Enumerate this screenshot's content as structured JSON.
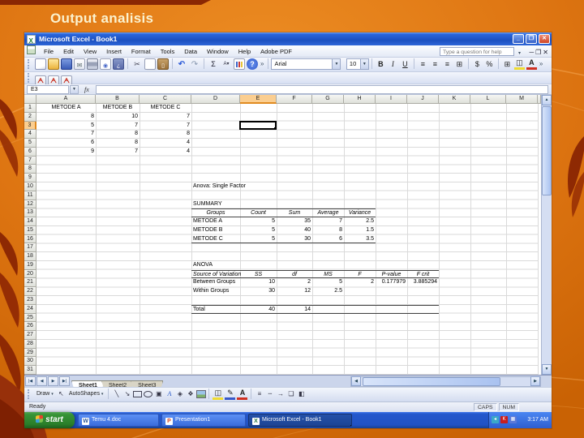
{
  "slide": {
    "title": "Output analisis"
  },
  "window": {
    "title": "Microsoft Excel - Book1"
  },
  "menu": {
    "items": [
      "File",
      "Edit",
      "View",
      "Insert",
      "Format",
      "Tools",
      "Data",
      "Window",
      "Help",
      "Adobe PDF"
    ],
    "help_box": "Type a question for help"
  },
  "toolbar": {
    "font_name": "Arial",
    "font_size": "10"
  },
  "formula_bar": {
    "name_box": "E3",
    "fx_label": "fx",
    "value": ""
  },
  "grid": {
    "columns": [
      "A",
      "B",
      "C",
      "D",
      "E",
      "F",
      "G",
      "H",
      "I",
      "J",
      "K",
      "L",
      "M"
    ],
    "row_count": 31,
    "selected_cell": {
      "col": "E",
      "row": 3
    },
    "cells": [
      {
        "r": 1,
        "c": "A",
        "t": "METODE A",
        "al": "c"
      },
      {
        "r": 1,
        "c": "B",
        "t": "METODE B",
        "al": "c"
      },
      {
        "r": 1,
        "c": "C",
        "t": "METODE C",
        "al": "c"
      },
      {
        "r": 2,
        "c": "A",
        "t": "8",
        "al": "r"
      },
      {
        "r": 2,
        "c": "B",
        "t": "10",
        "al": "r"
      },
      {
        "r": 2,
        "c": "C",
        "t": "7",
        "al": "r"
      },
      {
        "r": 3,
        "c": "A",
        "t": "5",
        "al": "r"
      },
      {
        "r": 3,
        "c": "B",
        "t": "7",
        "al": "r"
      },
      {
        "r": 3,
        "c": "C",
        "t": "7",
        "al": "r"
      },
      {
        "r": 4,
        "c": "A",
        "t": "7",
        "al": "r"
      },
      {
        "r": 4,
        "c": "B",
        "t": "8",
        "al": "r"
      },
      {
        "r": 4,
        "c": "C",
        "t": "8",
        "al": "r"
      },
      {
        "r": 5,
        "c": "A",
        "t": "6",
        "al": "r"
      },
      {
        "r": 5,
        "c": "B",
        "t": "8",
        "al": "r"
      },
      {
        "r": 5,
        "c": "C",
        "t": "4",
        "al": "r"
      },
      {
        "r": 6,
        "c": "A",
        "t": "9",
        "al": "r"
      },
      {
        "r": 6,
        "c": "B",
        "t": "7",
        "al": "r"
      },
      {
        "r": 6,
        "c": "C",
        "t": "4",
        "al": "r"
      },
      {
        "r": 10,
        "c": "D",
        "t": "Anova: Single Factor",
        "al": "l"
      },
      {
        "r": 12,
        "c": "D",
        "t": "SUMMARY",
        "al": "l"
      },
      {
        "r": 13,
        "c": "D",
        "t": "Groups",
        "al": "c",
        "it": true,
        "bt": true,
        "bb": true
      },
      {
        "r": 13,
        "c": "E",
        "t": "Count",
        "al": "c",
        "it": true,
        "bt": true,
        "bb": true
      },
      {
        "r": 13,
        "c": "F",
        "t": "Sum",
        "al": "c",
        "it": true,
        "bt": true,
        "bb": true
      },
      {
        "r": 13,
        "c": "G",
        "t": "Average",
        "al": "c",
        "it": true,
        "bt": true,
        "bb": true
      },
      {
        "r": 13,
        "c": "H",
        "t": "Variance",
        "al": "c",
        "it": true,
        "bt": true,
        "bb": true
      },
      {
        "r": 14,
        "c": "D",
        "t": "METODE A",
        "al": "l"
      },
      {
        "r": 14,
        "c": "E",
        "t": "5",
        "al": "r"
      },
      {
        "r": 14,
        "c": "F",
        "t": "35",
        "al": "r"
      },
      {
        "r": 14,
        "c": "G",
        "t": "7",
        "al": "r"
      },
      {
        "r": 14,
        "c": "H",
        "t": "2.5",
        "al": "r"
      },
      {
        "r": 15,
        "c": "D",
        "t": "METODE B",
        "al": "l"
      },
      {
        "r": 15,
        "c": "E",
        "t": "5",
        "al": "r"
      },
      {
        "r": 15,
        "c": "F",
        "t": "40",
        "al": "r"
      },
      {
        "r": 15,
        "c": "G",
        "t": "8",
        "al": "r"
      },
      {
        "r": 15,
        "c": "H",
        "t": "1.5",
        "al": "r"
      },
      {
        "r": 16,
        "c": "D",
        "t": "METODE C",
        "al": "l",
        "bb": true
      },
      {
        "r": 16,
        "c": "E",
        "t": "5",
        "al": "r",
        "bb": true
      },
      {
        "r": 16,
        "c": "F",
        "t": "30",
        "al": "r",
        "bb": true
      },
      {
        "r": 16,
        "c": "G",
        "t": "6",
        "al": "r",
        "bb": true
      },
      {
        "r": 16,
        "c": "H",
        "t": "3.5",
        "al": "r",
        "bb": true
      },
      {
        "r": 19,
        "c": "D",
        "t": "ANOVA",
        "al": "l"
      },
      {
        "r": 20,
        "c": "D",
        "t": "Source of Variation",
        "al": "l",
        "it": true,
        "bt": true,
        "bb": true
      },
      {
        "r": 20,
        "c": "E",
        "t": "SS",
        "al": "c",
        "it": true,
        "bt": true,
        "bb": true
      },
      {
        "r": 20,
        "c": "F",
        "t": "df",
        "al": "c",
        "it": true,
        "bt": true,
        "bb": true
      },
      {
        "r": 20,
        "c": "G",
        "t": "MS",
        "al": "c",
        "it": true,
        "bt": true,
        "bb": true
      },
      {
        "r": 20,
        "c": "H",
        "t": "F",
        "al": "c",
        "it": true,
        "bt": true,
        "bb": true
      },
      {
        "r": 20,
        "c": "I",
        "t": "P-value",
        "al": "c",
        "it": true,
        "bt": true,
        "bb": true
      },
      {
        "r": 20,
        "c": "J",
        "t": "F crit",
        "al": "c",
        "it": true,
        "bt": true,
        "bb": true
      },
      {
        "r": 21,
        "c": "D",
        "t": "Between Groups",
        "al": "l"
      },
      {
        "r": 21,
        "c": "E",
        "t": "10",
        "al": "r"
      },
      {
        "r": 21,
        "c": "F",
        "t": "2",
        "al": "r"
      },
      {
        "r": 21,
        "c": "G",
        "t": "5",
        "al": "r"
      },
      {
        "r": 21,
        "c": "H",
        "t": "2",
        "al": "r"
      },
      {
        "r": 21,
        "c": "I",
        "t": "0.177979",
        "al": "r"
      },
      {
        "r": 21,
        "c": "J",
        "t": "3.885294",
        "al": "r"
      },
      {
        "r": 22,
        "c": "D",
        "t": "Within Groups",
        "al": "l"
      },
      {
        "r": 22,
        "c": "E",
        "t": "30",
        "al": "r"
      },
      {
        "r": 22,
        "c": "F",
        "t": "12",
        "al": "r"
      },
      {
        "r": 22,
        "c": "G",
        "t": "2.5",
        "al": "r"
      },
      {
        "r": 24,
        "c": "D",
        "t": "Total",
        "al": "l",
        "bt": true,
        "bb": true
      },
      {
        "r": 24,
        "c": "E",
        "t": "40",
        "al": "r",
        "bt": true,
        "bb": true
      },
      {
        "r": 24,
        "c": "F",
        "t": "14",
        "al": "r",
        "bt": true,
        "bb": true
      },
      {
        "r": 24,
        "c": "G",
        "t": "",
        "al": "r",
        "bt": true,
        "bb": true
      },
      {
        "r": 24,
        "c": "H",
        "t": "",
        "al": "r",
        "bt": true,
        "bb": true
      },
      {
        "r": 24,
        "c": "I",
        "t": "",
        "al": "r",
        "bt": true,
        "bb": true
      },
      {
        "r": 24,
        "c": "J",
        "t": "",
        "al": "r",
        "bt": true,
        "bb": true
      }
    ]
  },
  "sheet_tabs": {
    "tabs": [
      "Sheet1",
      "Sheet2",
      "Sheet3"
    ],
    "active": "Sheet1"
  },
  "drawing_toolbar": {
    "draw_label": "Draw",
    "autoshapes_label": "AutoShapes"
  },
  "status_bar": {
    "mode": "Ready",
    "indicators": [
      "CAPS",
      "NUM"
    ]
  },
  "taskbar": {
    "start_label": "start",
    "windows": [
      {
        "label": "Temu 4.doc",
        "icon": "word-icon",
        "active": false
      },
      {
        "label": "Presentation1",
        "icon": "powerpoint-icon",
        "active": false
      },
      {
        "label": "Microsoft Excel - Book1",
        "icon": "excel-icon",
        "active": true
      }
    ],
    "clock": "3:17 AM"
  }
}
